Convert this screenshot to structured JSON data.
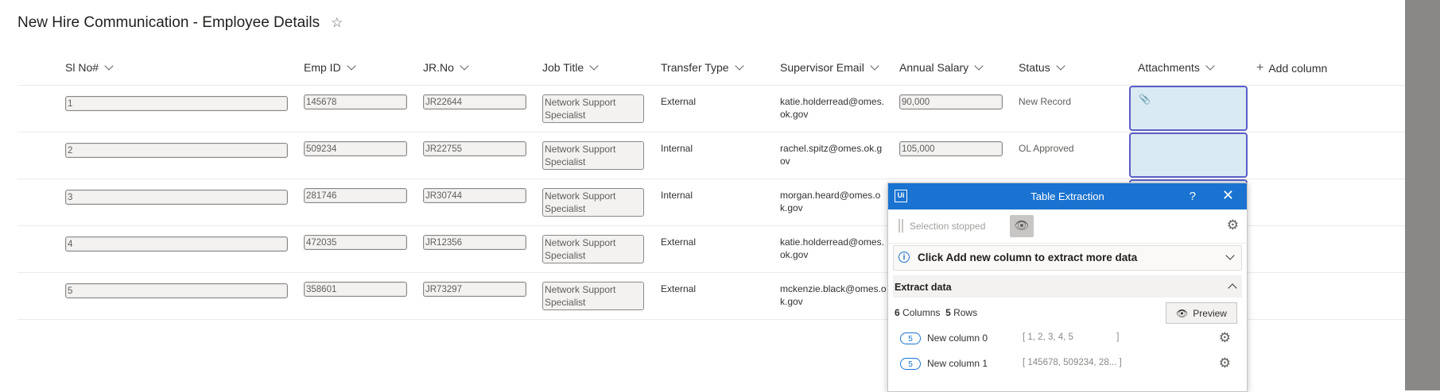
{
  "page": {
    "title": "New Hire Communication - Employee Details",
    "favorite_icon": "star-icon"
  },
  "columns": [
    {
      "label": "Sl No#"
    },
    {
      "label": "Emp ID"
    },
    {
      "label": "JR.No"
    },
    {
      "label": "Job Title"
    },
    {
      "label": "Transfer Type"
    },
    {
      "label": "Supervisor Email"
    },
    {
      "label": "Annual Salary"
    },
    {
      "label": "Status"
    },
    {
      "label": "Attachments"
    }
  ],
  "add_column_label": "Add column",
  "rows": [
    {
      "sl": "1",
      "emp_id": "145678",
      "jr": "JR22644",
      "job1": "Network Support",
      "job2": "Specialist",
      "transfer": "External",
      "email1": "katie.holderread@omes.",
      "email2": "ok.gov",
      "salary": "90,000",
      "status": "New Record",
      "attachment": true
    },
    {
      "sl": "2",
      "emp_id": "509234",
      "jr": "JR22755",
      "job1": "Network Support",
      "job2": "Specialist",
      "transfer": "Internal",
      "email1": "rachel.spitz@omes.ok.g",
      "email2": "ov",
      "salary": "105,000",
      "status": "OL Approved",
      "attachment": false
    },
    {
      "sl": "3",
      "emp_id": "281746",
      "jr": "JR30744",
      "job1": "Network Support",
      "job2": "Specialist",
      "transfer": "Internal",
      "email1": "morgan.heard@omes.o",
      "email2": "k.gov",
      "salary": "",
      "status": "",
      "attachment": false
    },
    {
      "sl": "4",
      "emp_id": "472035",
      "jr": "JR12356",
      "job1": "Network Support",
      "job2": "Specialist",
      "transfer": "External",
      "email1": "katie.holderread@omes.",
      "email2": "ok.gov",
      "salary": "",
      "status": "",
      "attachment": false
    },
    {
      "sl": "5",
      "emp_id": "358601",
      "jr": "JR73297",
      "job1": "Network Support",
      "job2": "Specialist",
      "transfer": "External",
      "email1": "mckenzie.black@omes.o",
      "email2": "k.gov",
      "salary": "",
      "status": "",
      "attachment": false
    }
  ],
  "panel": {
    "logo": "Ui",
    "title": "Table Extraction",
    "help": "?",
    "close": "✕",
    "selection_status": "Selection stopped",
    "info_message": "Click Add new column to extract more data",
    "extract_title": "Extract data",
    "columns_count": "6",
    "columns_label": "Columns",
    "rows_count": "5",
    "rows_label": "Rows",
    "preview_label": "Preview",
    "extracted_columns": [
      {
        "count": "5",
        "name": "New column 0",
        "values": "[ 1, 2, 3, 4, 5                 ]"
      },
      {
        "count": "5",
        "name": "New column 1",
        "values": "[ 145678, 509234, 28... ]"
      }
    ]
  },
  "colors": {
    "accent": "#1a73d0",
    "attachment_border": "#5b5fc7",
    "attachment_fill": "#daeaf3"
  }
}
